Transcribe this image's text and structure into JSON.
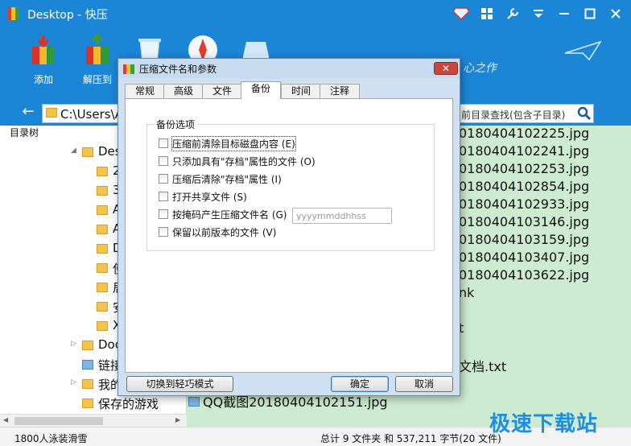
{
  "app": {
    "title": "Desktop - 快压",
    "colors": {
      "primary": "#1c86d6",
      "file_panel_bg": "#cdebd0"
    }
  },
  "toolbar": {
    "add_label": "添加",
    "extract_label": "解压到",
    "tagline": "心之作"
  },
  "address": {
    "path": "C:\\Users\\A",
    "search_placeholder": "前目录查找(包含子目录)"
  },
  "tree": {
    "header": "目录树",
    "items": [
      {
        "label": "Des"
      },
      {
        "label": "2"
      },
      {
        "label": "3"
      },
      {
        "label": "A"
      },
      {
        "label": "A"
      },
      {
        "label": "D"
      },
      {
        "label": "使"
      },
      {
        "label": "局"
      },
      {
        "label": "安"
      },
      {
        "label": "X"
      },
      {
        "label": "Doc"
      },
      {
        "label": "链接"
      },
      {
        "label": "我的"
      },
      {
        "label": "保存的游戏"
      }
    ]
  },
  "files": [
    "0180404102225.jpg",
    "0180404102241.jpg",
    "0180404102253.jpg",
    "0180404102854.jpg",
    "0180404102933.jpg",
    "0180404103146.jpg",
    "0180404103159.jpg",
    "0180404103407.jpg",
    "0180404103622.jpg",
    "nk",
    "t",
    "文档.txt",
    "QQ截图20180404102151.jpg"
  ],
  "status": {
    "left": "1800人泳装滑雪",
    "right": "总计 9 文件夹 和 537,211 字节(20 文件)"
  },
  "watermark": "极速下载站",
  "dialog": {
    "title": "压缩文件名和参数",
    "close_glyph": "✕",
    "tabs": [
      "常规",
      "高级",
      "文件",
      "备份",
      "时间",
      "注释"
    ],
    "active_tab": "备份",
    "group_title": "备份选项",
    "options": [
      {
        "label": "压缩前清除目标磁盘内容 (E)",
        "checked": false
      },
      {
        "label": "只添加具有\"存档\"属性的文件 (O)",
        "checked": false
      },
      {
        "label": "压缩后清除\"存档\"属性 (I)",
        "checked": false
      },
      {
        "label": "打开共享文件 (S)",
        "checked": false
      },
      {
        "label": "按掩码产生压缩文件名 (G)",
        "checked": false
      },
      {
        "label": "保留以前版本的文件 (V)",
        "checked": false
      }
    ],
    "mask_placeholder": "yyyymmddhhss",
    "buttons": {
      "switch_mode": "切换到轻巧模式",
      "ok": "确定",
      "cancel": "取消"
    }
  }
}
